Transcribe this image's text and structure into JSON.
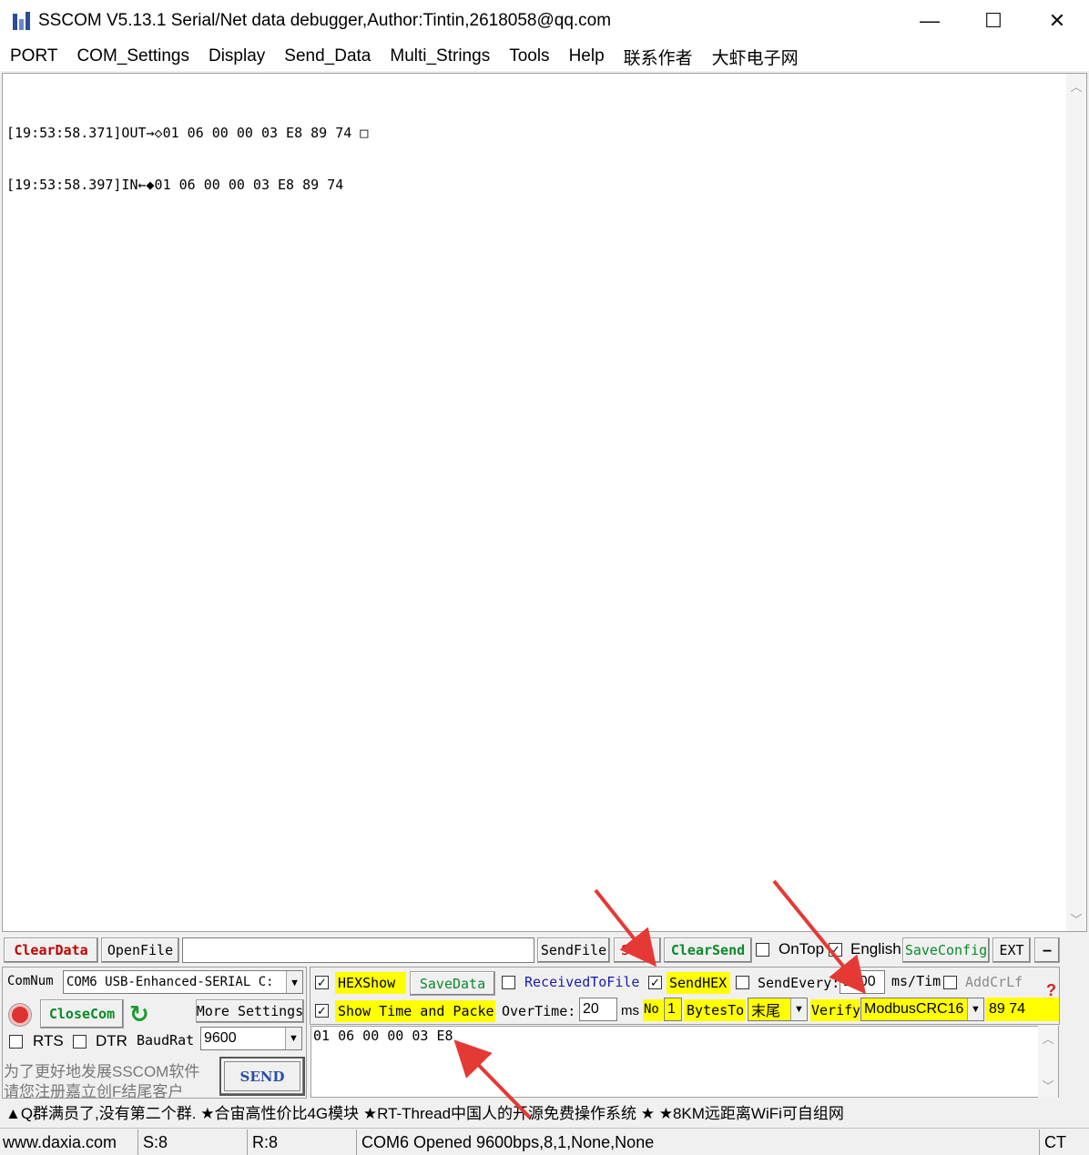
{
  "window": {
    "title": "SSCOM V5.13.1 Serial/Net data debugger,Author:Tintin,2618058@qq.com",
    "minimize": "—",
    "maximize": "☐",
    "close": "✕"
  },
  "menu": [
    "PORT",
    "COM_Settings",
    "Display",
    "Send_Data",
    "Multi_Strings",
    "Tools",
    "Help",
    "联系作者",
    "大虾电子网"
  ],
  "receive": {
    "lines": [
      "[19:53:58.371]OUT→◇01 06 00 00 03 E8 89 74 □",
      "[19:53:58.397]IN←◆01 06 00 00 03 E8 89 74"
    ]
  },
  "toolbar": {
    "clear_data": "ClearData",
    "open_file": "OpenFile",
    "file_path": "",
    "send_file": "SendFile",
    "stop": "Stop",
    "clear_send": "ClearSend",
    "on_top": "OnTop",
    "on_top_checked": false,
    "english": "English",
    "english_checked": true,
    "save_config": "SaveConfig",
    "ext": "EXT",
    "collapse": "—"
  },
  "port": {
    "com_num_label": "ComNum",
    "com_num_value": "COM6 USB-Enhanced-SERIAL C:",
    "close_com": "CloseCom",
    "more_settings": "More Settings",
    "rts": "RTS",
    "dtr": "DTR",
    "rts_checked": false,
    "dtr_checked": false,
    "baud_label": "BaudRat",
    "baud_value": "9600",
    "promo_line1": "为了更好地发展SSCOM软件",
    "promo_line2": "请您注册嘉立创F结尾客户",
    "send": "SEND"
  },
  "options": {
    "hex_show": "HEXShow",
    "hex_show_checked": true,
    "save_data": "SaveData",
    "received_to_file": "ReceivedToFile",
    "received_to_file_checked": false,
    "send_hex": "SendHEX",
    "send_hex_checked": true,
    "send_every": "SendEvery:",
    "send_every_checked": false,
    "send_every_value": "1000",
    "ms_tim": "ms/Tim",
    "add_crlf": "AddCrLf",
    "add_crlf_checked": false,
    "show_time": "Show Time and Packe",
    "show_time_checked": true,
    "overtime_label": "OverTime:",
    "overtime_value": "20",
    "ms": "ms",
    "no_label": "No",
    "no_value": "1",
    "bytes_to": "BytesTo",
    "bytes_to_value": "末尾",
    "verify": "Verify",
    "verify_value": "ModbusCRC16",
    "crc_result": "89 74",
    "help_mark": "?"
  },
  "send_input": "01 06 00 00 03 E8",
  "ticker": "▲Q群满员了,没有第二个群. ★合宙高性价比4G模块 ★RT-Thread中国人的开源免费操作系统 ★ ★8KM远距离WiFi可自组网",
  "status": {
    "site": "www.daxia.com",
    "sent": "S:8",
    "received": "R:8",
    "port_state": "COM6 Opened  9600bps,8,1,None,None",
    "cts": "CT"
  },
  "colors": {
    "highlight": "#ffff00",
    "clear_red": "#c00000",
    "action_green": "#0a8a2a",
    "link_blue": "#1a1ab0",
    "annotation_red": "#e53935"
  }
}
